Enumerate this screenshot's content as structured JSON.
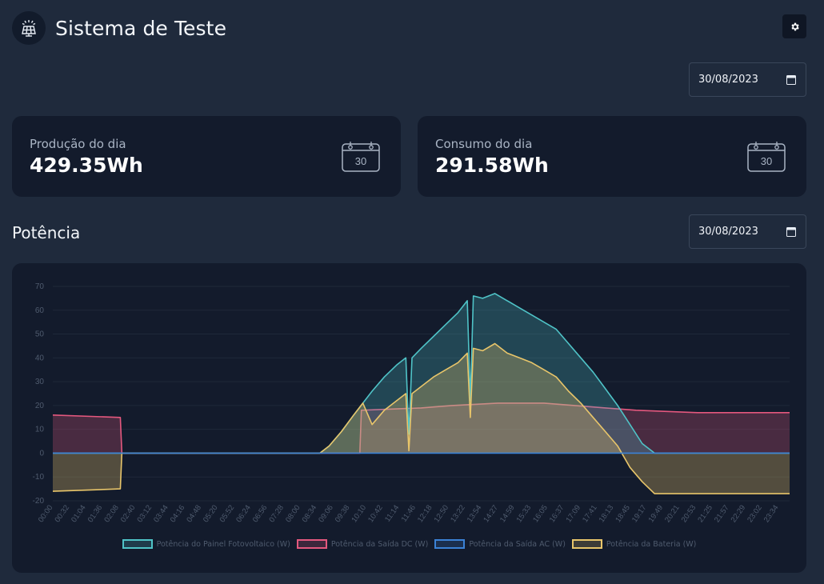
{
  "header": {
    "title": "Sistema de Teste",
    "logo_icon": "solar-panel-icon"
  },
  "toolbar": {
    "settings_icon": "gear-icon"
  },
  "date_filter": {
    "value": "30/08/2023"
  },
  "cards": [
    {
      "label": "Produção do dia",
      "value": "429.35Wh",
      "icon_day": "30"
    },
    {
      "label": "Consumo do dia",
      "value": "291.58Wh",
      "icon_day": "30"
    }
  ],
  "section": {
    "title": "Potência"
  },
  "chart_date_filter": {
    "value": "30/08/2023"
  },
  "colors": {
    "pv": "#4fc3c7",
    "dc": "#e4587e",
    "ac": "#3b82d6",
    "battery": "#e8c56a",
    "background": "#1f2a3c",
    "card": "#131b2c"
  },
  "chart_data": {
    "type": "area",
    "title": "",
    "xlabel": "",
    "ylabel": "",
    "ylim": [
      -20,
      70
    ],
    "yticks": [
      -20,
      -10,
      0,
      10,
      20,
      30,
      40,
      50,
      60,
      70
    ],
    "x_tick_labels": [
      "00:00",
      "00:32",
      "01:04",
      "01:36",
      "02:08",
      "02:40",
      "03:12",
      "03:44",
      "04:16",
      "04:48",
      "05:20",
      "05:52",
      "06:24",
      "06:56",
      "07:28",
      "08:00",
      "08:34",
      "09:06",
      "09:38",
      "10:10",
      "10:42",
      "11:14",
      "11:46",
      "12:18",
      "12:50",
      "13:22",
      "13:54",
      "14:27",
      "14:59",
      "15:33",
      "16:05",
      "16:37",
      "17:09",
      "17:41",
      "18:13",
      "18:45",
      "19:17",
      "19:49",
      "20:21",
      "20:53",
      "21:25",
      "21:57",
      "22:29",
      "23:02",
      "23:34"
    ],
    "legend_position": "bottom",
    "series": [
      {
        "name": "Potência do Painel Fotovoltaico (W)",
        "color": "#4fc3c7",
        "points": [
          [
            0,
            0
          ],
          [
            8.7,
            0
          ],
          [
            9.0,
            3
          ],
          [
            9.4,
            9
          ],
          [
            9.8,
            16
          ],
          [
            10.1,
            21
          ],
          [
            10.4,
            26
          ],
          [
            10.8,
            32
          ],
          [
            11.2,
            37
          ],
          [
            11.5,
            40
          ],
          [
            11.6,
            8
          ],
          [
            11.7,
            40
          ],
          [
            12.0,
            44
          ],
          [
            12.4,
            49
          ],
          [
            12.8,
            54
          ],
          [
            13.2,
            59
          ],
          [
            13.5,
            64
          ],
          [
            13.6,
            22
          ],
          [
            13.7,
            66
          ],
          [
            14.0,
            65
          ],
          [
            14.4,
            67
          ],
          [
            14.8,
            64
          ],
          [
            15.2,
            61
          ],
          [
            15.6,
            58
          ],
          [
            16.0,
            55
          ],
          [
            16.4,
            52
          ],
          [
            16.8,
            46
          ],
          [
            17.2,
            40
          ],
          [
            17.6,
            34
          ],
          [
            18.0,
            27
          ],
          [
            18.4,
            20
          ],
          [
            18.8,
            12
          ],
          [
            19.2,
            4
          ],
          [
            19.6,
            0
          ],
          [
            24,
            0
          ]
        ]
      },
      {
        "name": "Potência da Saída DC (W)",
        "color": "#e4587e",
        "points": [
          [
            0,
            16
          ],
          [
            2.2,
            15
          ],
          [
            2.25,
            0
          ],
          [
            10.0,
            0
          ],
          [
            10.05,
            18
          ],
          [
            12.0,
            19
          ],
          [
            13.0,
            20
          ],
          [
            14.5,
            21
          ],
          [
            16.0,
            21
          ],
          [
            17.0,
            20
          ],
          [
            18.0,
            19
          ],
          [
            19.0,
            18
          ],
          [
            21.0,
            17
          ],
          [
            24,
            17
          ]
        ]
      },
      {
        "name": "Potência da Saída AC (W)",
        "color": "#3b82d6",
        "points": [
          [
            0,
            0
          ],
          [
            24,
            0
          ]
        ]
      },
      {
        "name": "Potência da Bateria (W)",
        "color": "#e8c56a",
        "points": [
          [
            0,
            -16
          ],
          [
            2.2,
            -15
          ],
          [
            2.25,
            0
          ],
          [
            8.7,
            0
          ],
          [
            9.0,
            3
          ],
          [
            9.4,
            9
          ],
          [
            9.8,
            16
          ],
          [
            10.1,
            21
          ],
          [
            10.4,
            12
          ],
          [
            10.8,
            18
          ],
          [
            11.2,
            22
          ],
          [
            11.5,
            25
          ],
          [
            11.6,
            1
          ],
          [
            11.7,
            25
          ],
          [
            12.0,
            28
          ],
          [
            12.4,
            32
          ],
          [
            12.8,
            35
          ],
          [
            13.2,
            38
          ],
          [
            13.5,
            42
          ],
          [
            13.6,
            15
          ],
          [
            13.7,
            44
          ],
          [
            14.0,
            43
          ],
          [
            14.4,
            46
          ],
          [
            14.8,
            42
          ],
          [
            15.2,
            40
          ],
          [
            15.6,
            38
          ],
          [
            16.0,
            35
          ],
          [
            16.4,
            32
          ],
          [
            16.8,
            26
          ],
          [
            17.2,
            21
          ],
          [
            17.6,
            15
          ],
          [
            18.0,
            9
          ],
          [
            18.4,
            3
          ],
          [
            18.8,
            -6
          ],
          [
            19.2,
            -12
          ],
          [
            19.6,
            -17
          ],
          [
            21.0,
            -17
          ],
          [
            24,
            -17
          ]
        ]
      }
    ]
  }
}
